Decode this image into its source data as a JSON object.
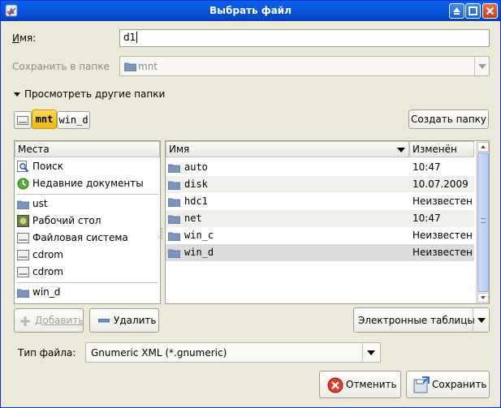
{
  "window": {
    "title": "Выбрать файл"
  },
  "name_row": {
    "label_u": "И",
    "label_rest": "мя:",
    "value": "d1"
  },
  "save_in": {
    "label": "Сохранить в папке",
    "value": "mnt"
  },
  "browse": {
    "label": "Просмотреть другие папки"
  },
  "path_bar": {
    "items": [
      "mnt",
      "win_d"
    ]
  },
  "create_folder": {
    "label": "Создать папку"
  },
  "places": {
    "header": "Места",
    "items": [
      {
        "label": "Поиск",
        "icon": "search-icon"
      },
      {
        "label": "Недавние документы",
        "icon": "recent-icon"
      },
      {
        "label": "ust",
        "icon": "folder-icon"
      },
      {
        "label": "Рабочий стол",
        "icon": "desktop-icon"
      },
      {
        "label": "Файловая система",
        "icon": "drive-icon"
      },
      {
        "label": "cdrom",
        "icon": "cdrom-icon"
      },
      {
        "label": "cdrom",
        "icon": "cdrom-icon"
      },
      {
        "label": "win_d",
        "icon": "folder-icon"
      }
    ]
  },
  "files": {
    "col_name": "Имя",
    "col_modified": "Изменён",
    "rows": [
      {
        "name": "auto",
        "modified": "10:47"
      },
      {
        "name": "disk",
        "modified": "10.07.2009"
      },
      {
        "name": "hdc1",
        "modified": "Неизвестен"
      },
      {
        "name": "net",
        "modified": "10:47"
      },
      {
        "name": "win_c",
        "modified": "Неизвестен"
      },
      {
        "name": "win_d",
        "modified": "Неизвестен"
      }
    ]
  },
  "actions": {
    "add": "Добавить",
    "remove": "Удалить"
  },
  "filter": {
    "value": "Электронные таблицы"
  },
  "file_type": {
    "label": "Тип файла:",
    "value": "Gnumeric XML (*.gnumeric)"
  },
  "buttons": {
    "cancel": "Отменить",
    "save": "Сохранить"
  },
  "colors": {
    "title_bar": "#0a5fe8",
    "window_bg": "#ece9d8",
    "path_active": "#f5c21f"
  }
}
